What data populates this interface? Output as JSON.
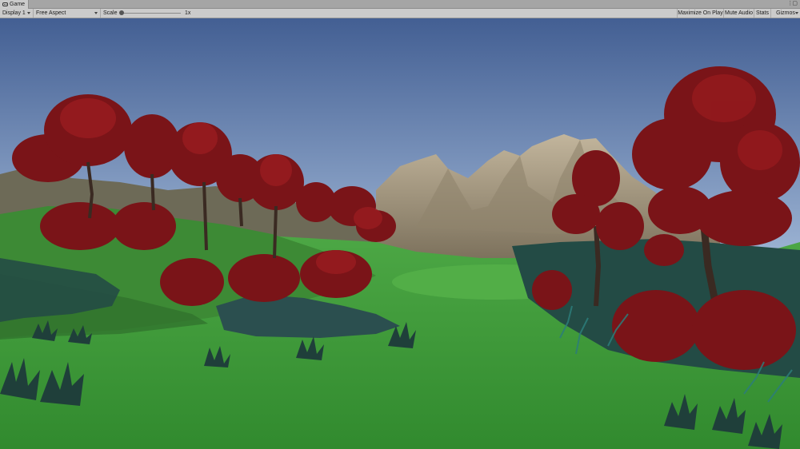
{
  "window": {
    "tab_label": "Game",
    "tab_icon": "gamepad-icon",
    "menu_icon": "kebab-menu-icon"
  },
  "toolbar": {
    "display_label": "Display 1",
    "aspect_label": "Free Aspect",
    "scale_label": "Scale",
    "scale_value": "1x",
    "scale_level": 1,
    "maximize_label": "Maximize On Play",
    "mute_label": "Mute Audio",
    "stats_label": "Stats",
    "gizmos_label": "Gizmos"
  },
  "scene": {
    "sky_top": "#435f93",
    "sky_bottom": "#9db4d4",
    "grass": "#3f9a3a",
    "foliage_red": "#7a1418",
    "mountain": "#a89a82"
  }
}
